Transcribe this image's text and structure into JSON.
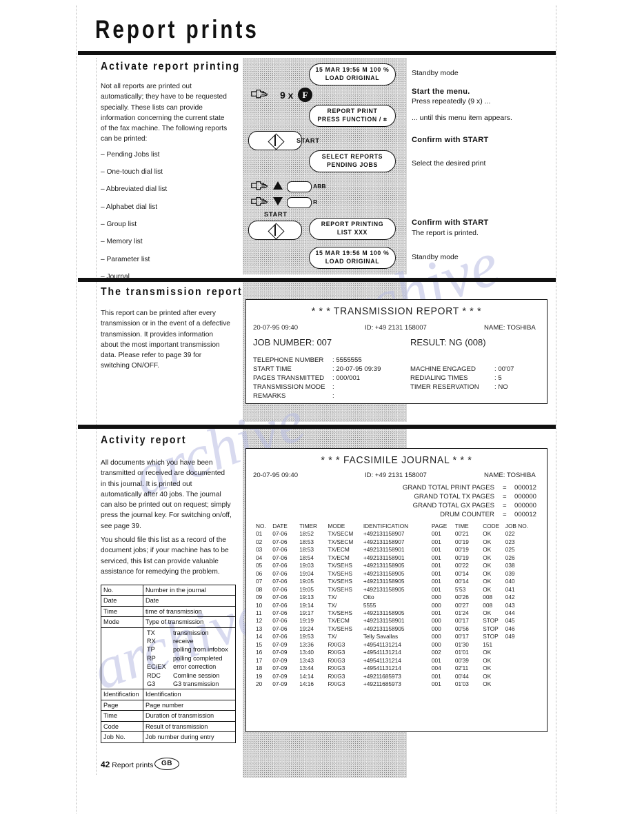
{
  "page": {
    "title": "Report prints",
    "footer_page_number": "42",
    "footer_title": "Report prints",
    "footer_locale": "GB"
  },
  "sections": {
    "activate": {
      "heading": "Activate report printing",
      "paragraph": "Not all reports are printed out automatically; they have to be requested specially. These lists can provide information concerning the current state of the fax machine. The following reports can be printed:",
      "reports": [
        "– Pending Jobs list",
        "– One-touch dial list",
        "– Abbreviated dial list",
        "– Alphabet dial list",
        "– Group list",
        "– Memory list",
        "– Parameter list",
        "– Journal"
      ]
    },
    "transmission": {
      "heading": "The transmission report",
      "paragraph": "This report can be printed after every transmission or in the event of a defective transmission. It provides information about the most important transmission data. Please refer to page 39 for switching ON/OFF."
    },
    "activity": {
      "heading": "Activity report",
      "paragraph1": "All documents which you have been transmitted or received are documented in this journal. It is printed out automatically after 40 jobs. The journal can also be printed out on request; simply press the journal key. For switching on/off, see page 39.",
      "paragraph2": "You should file this list as a record of the document jobs; if your machine has to be serviced, this list can provide valuable assistance for remedying the problem."
    }
  },
  "diagram": {
    "displays": {
      "standby_top": {
        "line1": "15 MAR  19:56  M 100 %",
        "line2": "LOAD ORIGINAL"
      },
      "report_print": {
        "line1": "REPORT PRINT",
        "line2": "PRESS FUNCTION / ⌗"
      },
      "select_reports": {
        "line1": "SELECT REPORTS",
        "line2": "PENDING JOBS"
      },
      "report_printing": {
        "line1": "REPORT PRINTING",
        "line2": "LIST    XXX"
      },
      "standby_bottom": {
        "line1": "15 MAR  19:56  M 100 %",
        "line2": "LOAD ORIGINAL"
      }
    },
    "keys": {
      "repeat_count": "9 x",
      "function_key": "F",
      "start_label_1": "START",
      "start_label_2": "START",
      "abb_label": "ABB",
      "r_label": "R"
    },
    "annotations": {
      "a1": "Standby mode",
      "a2_bold": "Start the menu.",
      "a2_text": "Press repeatedly (9 x) ...",
      "a3": "... until this menu item appears.",
      "a4_bold": "Confirm with START",
      "a5": "Select the desired print",
      "a6_bold": "Confirm with START",
      "a6_text": "The report is printed.",
      "a7": "Standby mode"
    }
  },
  "transmission_report": {
    "title": "*  *  *   TRANSMISSION REPORT   *  *  *",
    "datetime": "20-07-95  09:40",
    "id": "ID: +49  2131  158007",
    "name": "NAME: TOSHIBA",
    "job_number": "JOB NUMBER: 007",
    "result": "RESULT: NG   (008)",
    "left_fields": [
      {
        "label": "TELEPHONE NUMBER",
        "value": ": 5555555"
      },
      {
        "label": "START TIME",
        "value": ": 20-07-95  09:39"
      },
      {
        "label": "PAGES TRANSMITTED",
        "value": ": 000/001"
      },
      {
        "label": "TRANSMISSION MODE",
        "value": ":"
      },
      {
        "label": "REMARKS",
        "value": ":"
      }
    ],
    "right_fields": [
      {
        "label": "MACHINE ENGAGED",
        "value": ": 00'07"
      },
      {
        "label": "REDIALING TIMES",
        "value": ": 5"
      },
      {
        "label": "TIMER RESERVATION",
        "value": ": NO"
      }
    ]
  },
  "facsimile_journal": {
    "title": "*  *  *   FACSIMILE JOURNAL   *  *  *",
    "datetime": "20-07-95  09:40",
    "id": "ID: +49  2131  158007",
    "name": "NAME: TOSHIBA",
    "totals": [
      {
        "label": "GRAND TOTAL PRINT PAGES",
        "eq": "=",
        "value": "000012"
      },
      {
        "label": "GRAND TOTAL TX PAGES",
        "eq": "=",
        "value": "000000"
      },
      {
        "label": "GRAND TOTAL GX PAGES",
        "eq": "=",
        "value": "000000"
      },
      {
        "label": "DRUM COUNTER",
        "eq": "=",
        "value": "000012"
      }
    ],
    "columns": [
      "NO.",
      "DATE",
      "TIMER",
      "MODE",
      "IDENTIFICATION",
      "PAGE",
      "TIME",
      "CODE",
      "JOB NO."
    ],
    "rows": [
      [
        "01",
        "07-06",
        "18:52",
        "TX/SECM",
        "+492131158907",
        "001",
        "00'21",
        "OK",
        "022"
      ],
      [
        "02",
        "07-06",
        "18:53",
        "TX/SECM",
        "+492131158907",
        "001",
        "00'19",
        "OK",
        "023"
      ],
      [
        "03",
        "07-06",
        "18:53",
        "TX/ECM",
        "+492131158901",
        "001",
        "00'19",
        "OK",
        "025"
      ],
      [
        "04",
        "07-06",
        "18:54",
        "TX/ECM",
        "+492131158901",
        "001",
        "00'19",
        "OK",
        "026"
      ],
      [
        "05",
        "07-06",
        "19:03",
        "TX/SEHS",
        "+492131158905",
        "001",
        "00'22",
        "OK",
        "038"
      ],
      [
        "06",
        "07-06",
        "19:04",
        "TX/SEHS",
        "+492131158905",
        "001",
        "00'14",
        "OK",
        "039"
      ],
      [
        "07",
        "07-06",
        "19:05",
        "TX/SEHS",
        "+492131158905",
        "001",
        "00'14",
        "OK",
        "040"
      ],
      [
        "08",
        "07-06",
        "19:05",
        "TX/SEHS",
        "+492131158905",
        "001",
        "5'53",
        "OK",
        "041"
      ],
      [
        "09",
        "07-06",
        "19:13",
        "TX/",
        "Otto",
        "000",
        "00'26",
        "008",
        "042"
      ],
      [
        "10",
        "07-06",
        "19:14",
        "TX/",
        "5555",
        "000",
        "00'27",
        "008",
        "043"
      ],
      [
        "11",
        "07-06",
        "19:17",
        "TX/SEHS",
        "+492131158905",
        "001",
        "01'24",
        "OK",
        "044"
      ],
      [
        "12",
        "07-06",
        "19:19",
        "TX/ECM",
        "+492131158901",
        "000",
        "00'17",
        "STOP",
        "045"
      ],
      [
        "13",
        "07-06",
        "19:24",
        "TX/SEHS",
        "+492131158905",
        "000",
        "00'56",
        "STOP",
        "046"
      ],
      [
        "14",
        "07-06",
        "19:53",
        "TX/",
        "Telly Savallas",
        "000",
        "00'17",
        "STOP",
        "049"
      ],
      [
        "15",
        "07-09",
        "13:36",
        "RX/G3",
        "+49541131214",
        "000",
        "01'30",
        "151",
        ""
      ],
      [
        "16",
        "07-09",
        "13:40",
        "RX/G3",
        "+49541131214",
        "002",
        "01'01",
        "OK",
        ""
      ],
      [
        "17",
        "07-09",
        "13:43",
        "RX/G3",
        "+49541131214",
        "001",
        "00'39",
        "OK",
        ""
      ],
      [
        "18",
        "07-09",
        "13:44",
        "RX/G3",
        "+49541131214",
        "004",
        "02'11",
        "OK",
        ""
      ],
      [
        "19",
        "07-09",
        "14:14",
        "RX/G3",
        "+49211685973",
        "001",
        "00'44",
        "OK",
        ""
      ],
      [
        "20",
        "07-09",
        "14:16",
        "RX/G3",
        "+49211685973",
        "001",
        "01'03",
        "OK",
        ""
      ]
    ]
  },
  "legend_table": {
    "rows": [
      {
        "key": "No.",
        "value": "Number in the journal"
      },
      {
        "key": "Date",
        "value": "Date"
      },
      {
        "key": "Time",
        "value": "time of transmission"
      },
      {
        "key": "Mode",
        "value": "Type of transmission"
      }
    ],
    "mode_codes": [
      {
        "abbr": "TX",
        "meaning": "transmission"
      },
      {
        "abbr": "RX",
        "meaning": "receive"
      },
      {
        "abbr": "TP",
        "meaning": "polling from infobox"
      },
      {
        "abbr": "RP",
        "meaning": "polling completed"
      },
      {
        "abbr": "EC/EX",
        "meaning": "error correction"
      },
      {
        "abbr": "RDC",
        "meaning": "Comline session"
      },
      {
        "abbr": "G3",
        "meaning": "G3 transmission"
      }
    ],
    "rows2": [
      {
        "key": "Identification",
        "value": "Identification"
      },
      {
        "key": "Page",
        "value": "Page number"
      },
      {
        "key": "Time",
        "value": "Duration of transmission"
      },
      {
        "key": "Code",
        "value": "Result of transmission"
      },
      {
        "key": "Job No.",
        "value": "Job number during entry"
      }
    ]
  },
  "watermark": {
    "text": "archive"
  }
}
